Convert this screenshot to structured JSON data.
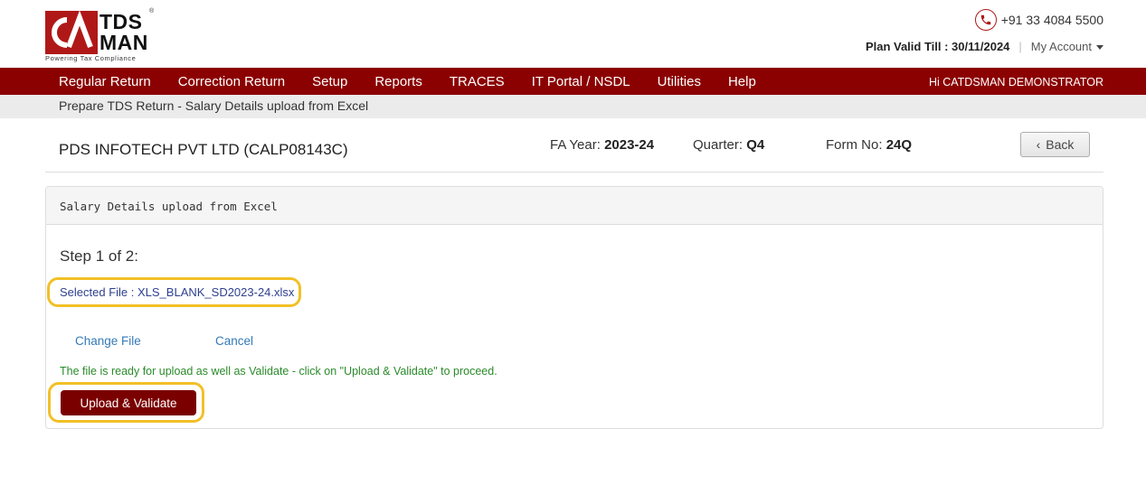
{
  "brand": {
    "logo_top": "TDS",
    "logo_bottom": "MAN",
    "tagline": "Powering Tax Compliance",
    "registered": "®",
    "accent_color": "#8b0000"
  },
  "header": {
    "phone": "+91 33 4084 5500",
    "plan_label": "Plan Valid Till : 30/11/2024",
    "separator": "|",
    "my_account": "My Account"
  },
  "nav": {
    "items": [
      {
        "label": "Regular Return"
      },
      {
        "label": "Correction Return"
      },
      {
        "label": "Setup"
      },
      {
        "label": "Reports"
      },
      {
        "label": "TRACES"
      },
      {
        "label": "IT Portal / NSDL"
      },
      {
        "label": "Utilities"
      },
      {
        "label": "Help"
      }
    ],
    "greeting": "Hi CATDSMAN DEMONSTRATOR"
  },
  "breadcrumb": "Prepare TDS Return - Salary Details upload from Excel",
  "context": {
    "company": "PDS INFOTECH PVT LTD (CALP08143C)",
    "fa_year_label": "FA Year:",
    "fa_year_value": "2023-24",
    "quarter_label": "Quarter:",
    "quarter_value": "Q4",
    "form_label": "Form No:",
    "form_value": "24Q",
    "back_label": "Back"
  },
  "panel": {
    "heading": "Salary Details upload from Excel",
    "step": "Step 1 of 2:",
    "selected_file": "Selected File : XLS_BLANK_SD2023-24.xlsx",
    "change_file": "Change File",
    "cancel": "Cancel",
    "status_message": "The file is ready for upload as well as Validate - click on \"Upload & Validate\" to proceed.",
    "upload_button": "Upload & Validate"
  }
}
